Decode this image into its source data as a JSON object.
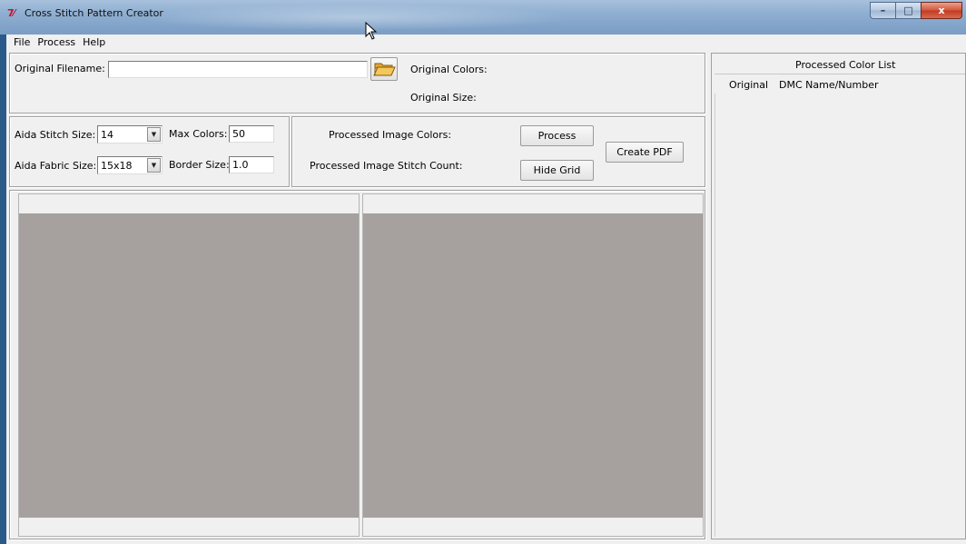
{
  "window": {
    "title": "Cross Stitch Pattern Creator",
    "minimize_glyph": "–",
    "maximize_glyph": "□",
    "close_glyph": "x"
  },
  "menu": {
    "items": [
      {
        "label": "File"
      },
      {
        "label": "Process"
      },
      {
        "label": "Help"
      }
    ]
  },
  "file_section": {
    "filename_label": "Original Filename:",
    "filename_value": "",
    "original_colors_label": "Original Colors:",
    "original_size_label": "Original Size:",
    "browse_icon": "folder-open-icon"
  },
  "settings": {
    "stitch_size_label": "Aida Stitch Size:",
    "stitch_size_value": "14",
    "fabric_size_label": "Aida Fabric Size:",
    "fabric_size_value": "15x18",
    "max_colors_label": "Max Colors:",
    "max_colors_value": "50",
    "border_size_label": "Border Size:",
    "border_size_value": "1.0"
  },
  "processing": {
    "image_colors_label": "Processed Image Colors:",
    "stitch_count_label": "Processed Image Stitch Count:",
    "process_button": "Process",
    "hide_grid_button": "Hide Grid",
    "create_pdf_button": "Create PDF"
  },
  "color_list": {
    "title": "Processed Color List",
    "columns": [
      "Original",
      "DMC Name/Number"
    ]
  },
  "colors": {
    "canvas_gray": "#a6a19e",
    "window_bg": "#f0f0f0",
    "title_gradient_top": "#a7c0dc"
  }
}
